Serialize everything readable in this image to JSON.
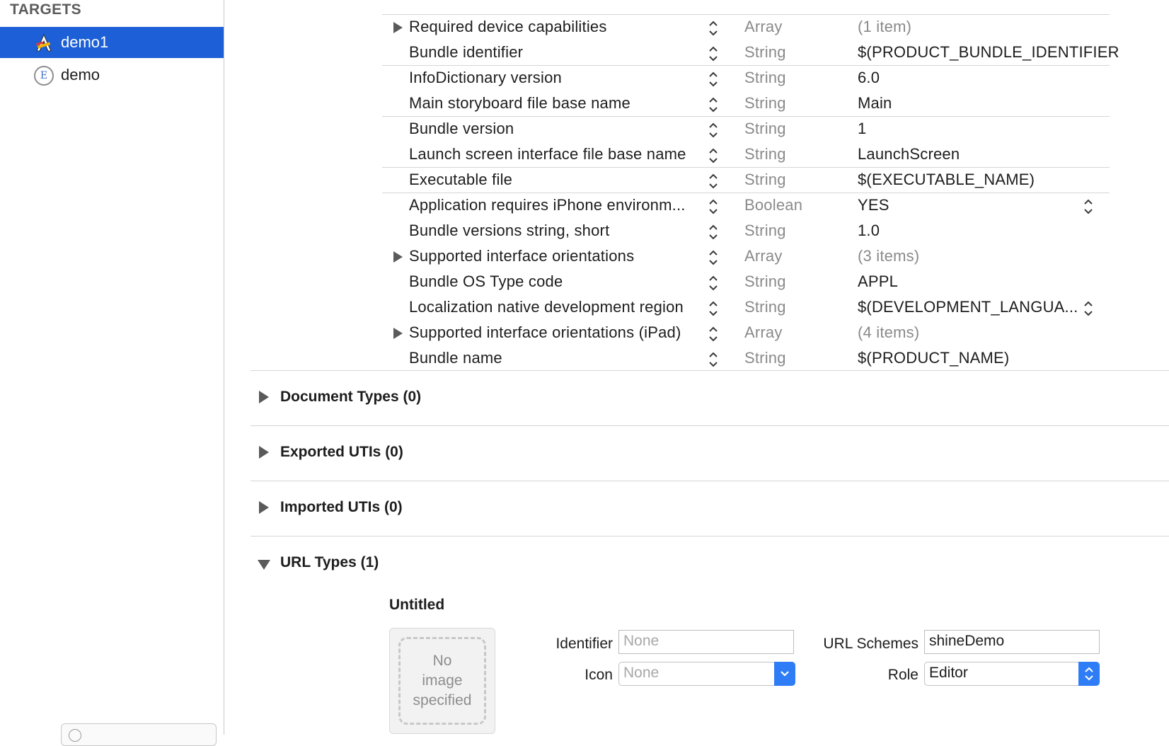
{
  "sidebar": {
    "header": "TARGETS",
    "targets": [
      {
        "label": "demo1",
        "selected": true,
        "icon": "app-target-icon"
      },
      {
        "label": "demo",
        "selected": false,
        "icon": "extension-icon",
        "icon_letter": "E"
      }
    ]
  },
  "info_plist": {
    "rows": [
      {
        "key": "Required device capabilities",
        "type": "Array",
        "value": "(1 item)",
        "expandable": true
      },
      {
        "key": "Bundle identifier",
        "type": "String",
        "value": "$(PRODUCT_BUNDLE_IDENTIFIER"
      },
      {
        "key": "InfoDictionary version",
        "type": "String",
        "value": "6.0"
      },
      {
        "key": "Main storyboard file base name",
        "type": "String",
        "value": "Main"
      },
      {
        "key": "Bundle version",
        "type": "String",
        "value": "1"
      },
      {
        "key": "Launch screen interface file base name",
        "type": "String",
        "value": "LaunchScreen"
      },
      {
        "key": "Executable file",
        "type": "String",
        "value": "$(EXECUTABLE_NAME)"
      },
      {
        "key": "Application requires iPhone environm...",
        "type": "Boolean",
        "value": "YES"
      },
      {
        "key": "Bundle versions string, short",
        "type": "String",
        "value": "1.0"
      },
      {
        "key": "Supported interface orientations",
        "type": "Array",
        "value": "(3 items)",
        "expandable": true
      },
      {
        "key": "Bundle OS Type code",
        "type": "String",
        "value": "APPL"
      },
      {
        "key": "Localization native development region",
        "type": "String",
        "value": "$(DEVELOPMENT_LANGUA..."
      },
      {
        "key": "Supported interface orientations (iPad)",
        "type": "Array",
        "value": "(4 items)",
        "expandable": true
      },
      {
        "key": "Bundle name",
        "type": "String",
        "value": "$(PRODUCT_NAME)"
      }
    ]
  },
  "sections": {
    "document_types": "Document Types (0)",
    "exported_utis": "Exported UTIs (0)",
    "imported_utis": "Imported UTIs (0)",
    "url_types": "URL Types (1)"
  },
  "url_type": {
    "title": "Untitled",
    "image_placeholder": [
      "No",
      "image",
      "specified"
    ],
    "identifier_label": "Identifier",
    "identifier_placeholder": "None",
    "icon_label": "Icon",
    "icon_value": "None",
    "url_schemes_label": "URL Schemes",
    "url_schemes_value": "shineDemo",
    "role_label": "Role",
    "role_value": "Editor"
  },
  "colors": {
    "selection": "#1c5fd6",
    "popup_button": "#2f7df6",
    "muted_text": "#8a8a8a"
  }
}
